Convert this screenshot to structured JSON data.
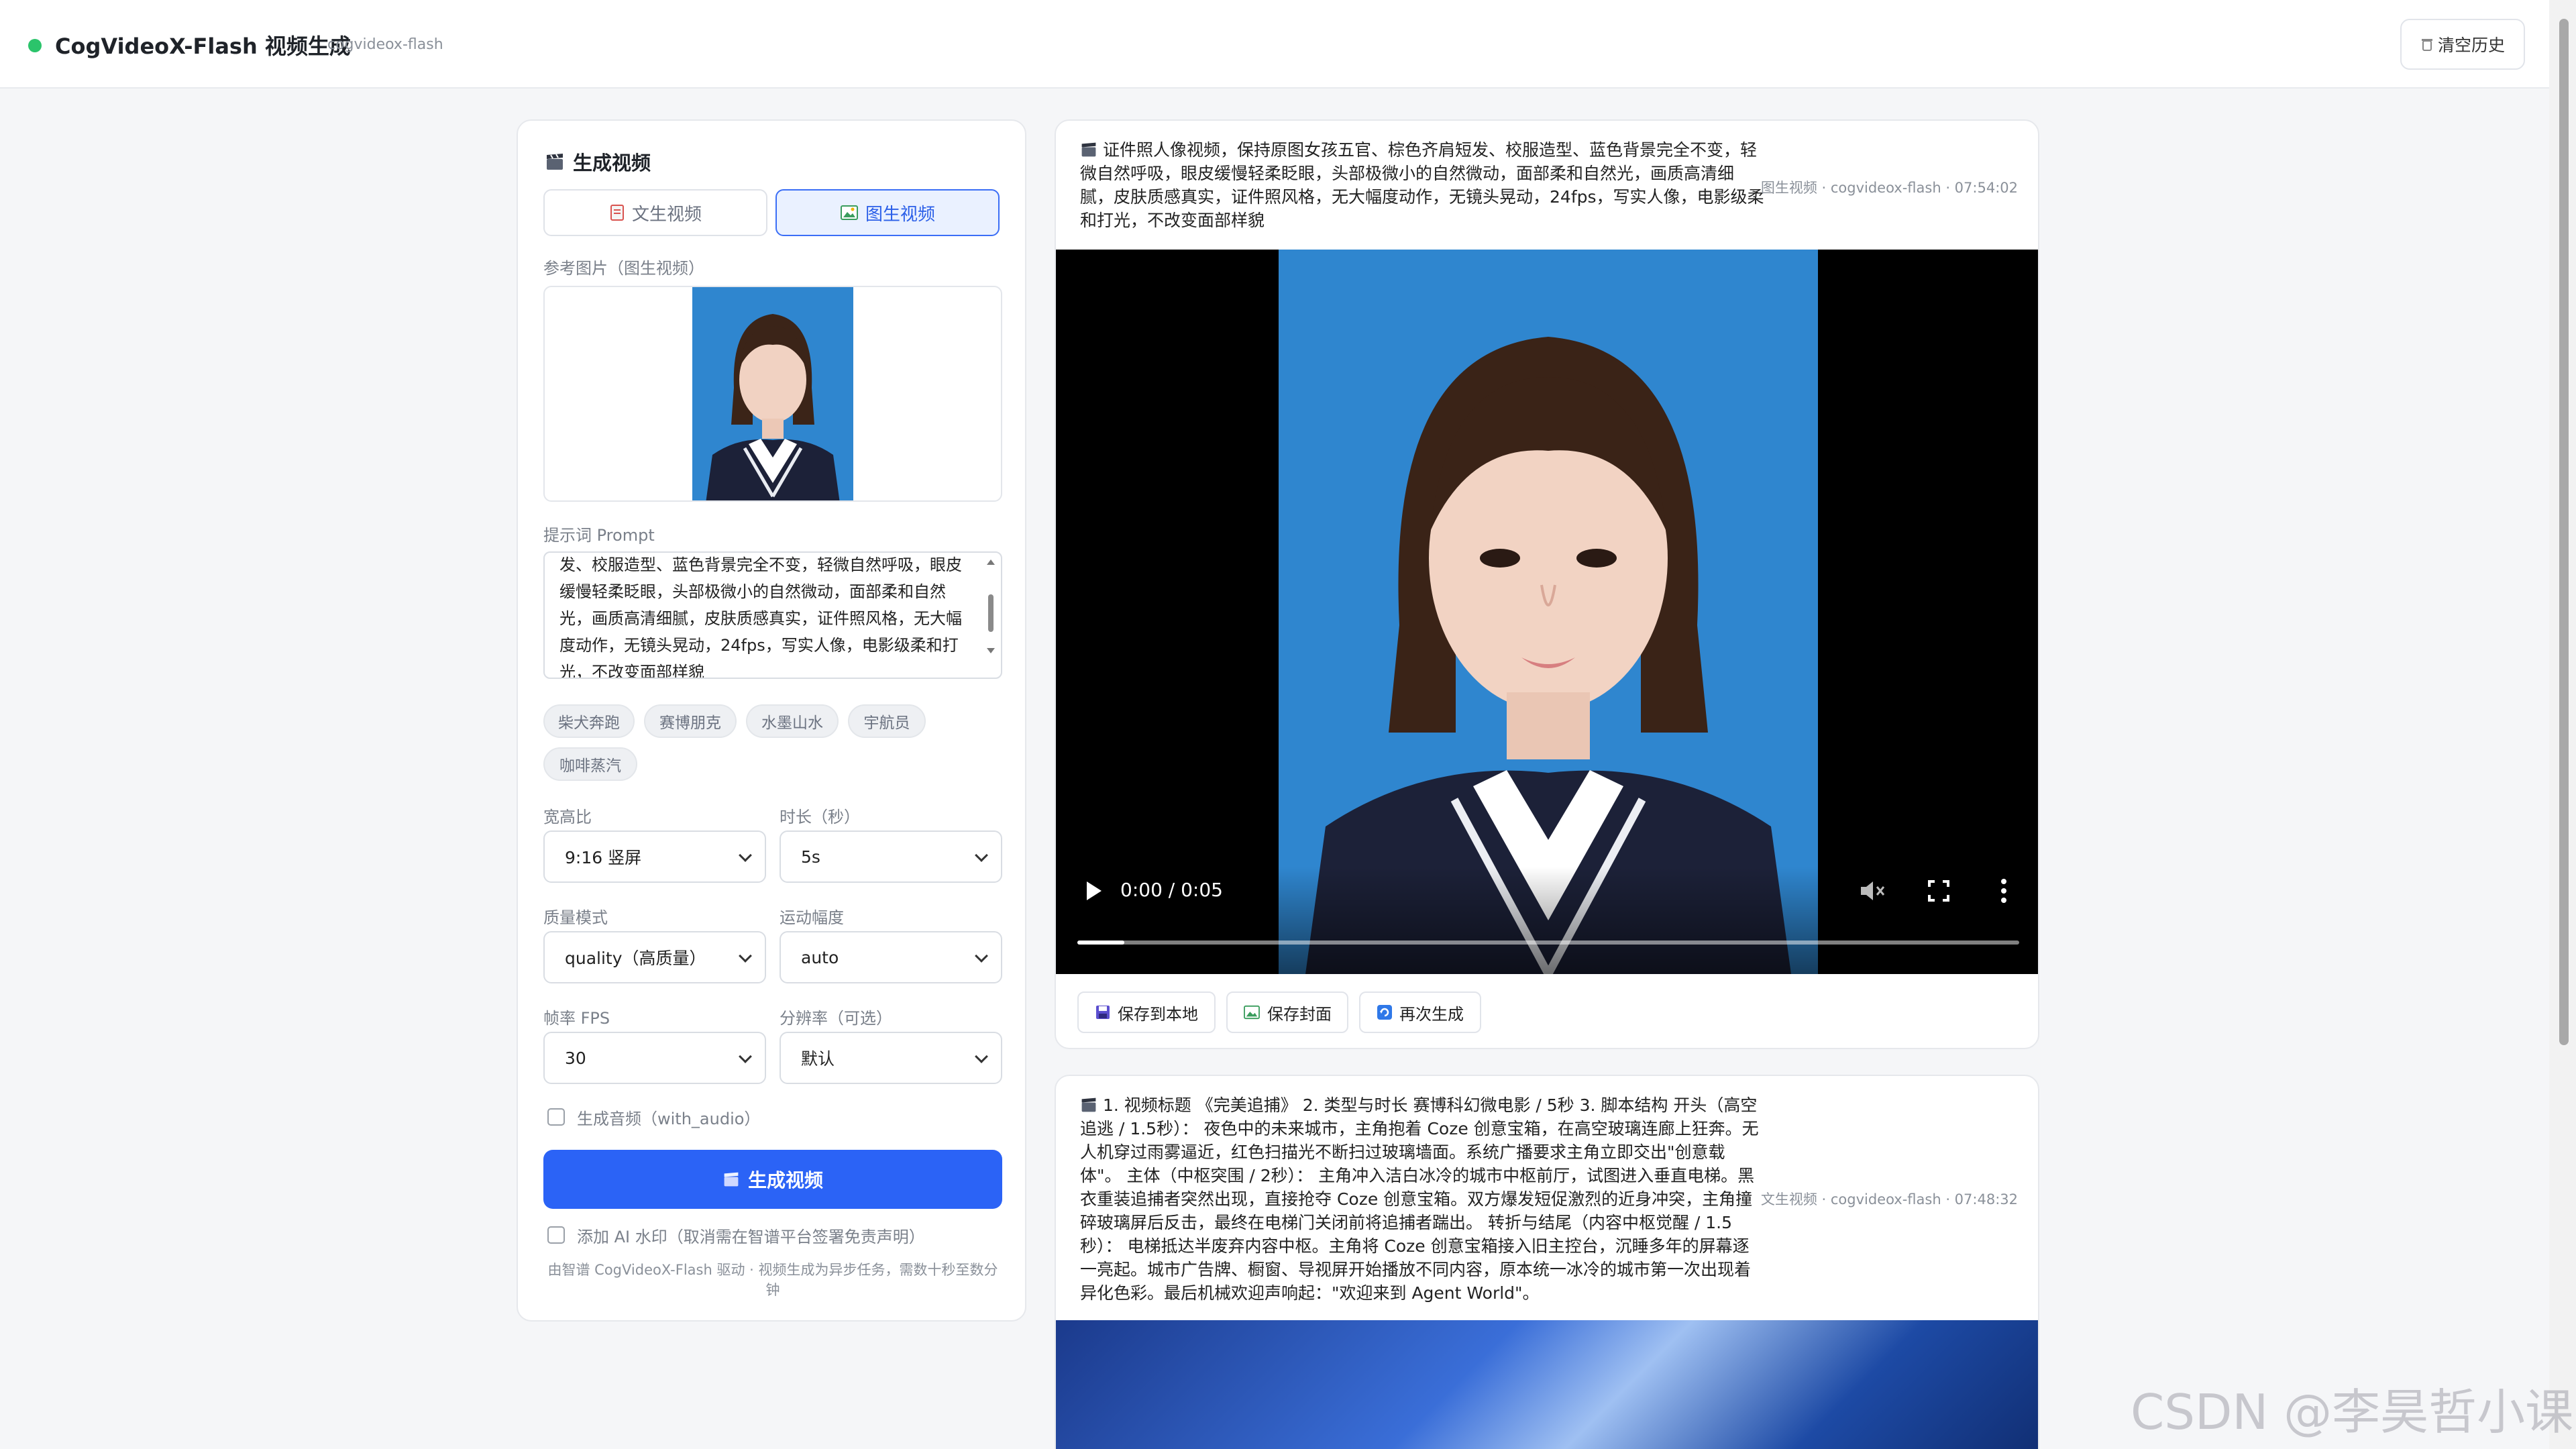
{
  "header": {
    "title": "CogVideoX-Flash 视频生成",
    "model": "cogvideox-flash",
    "clear_history": "清空历史"
  },
  "panel": {
    "title": "生成视频",
    "tabs": [
      {
        "label": "文生视频",
        "active": false
      },
      {
        "label": "图生视频",
        "active": true
      }
    ],
    "ref_image_label": "参考图片（图生视频）",
    "prompt_label": "提示词 Prompt",
    "prompt_value": "发、校服造型、蓝色背景完全不变，轻微自然呼吸，眼皮缓慢轻柔眨眼，头部极微小的自然微动，面部柔和自然光，画质高清细腻，皮肤质感真实，证件照风格，无大幅度动作，无镜头晃动，24fps，写实人像，电影级柔和打光，不改变面部样貌",
    "chips": [
      "柴犬奔跑",
      "赛博朋克",
      "水墨山水",
      "宇航员",
      "咖啡蒸汽"
    ],
    "fields": {
      "aspect": {
        "label": "宽高比",
        "value": "9:16 竖屏"
      },
      "duration": {
        "label": "时长（秒）",
        "value": "5s"
      },
      "quality": {
        "label": "质量模式",
        "value": "quality（高质量）"
      },
      "motion": {
        "label": "运动幅度",
        "value": "auto"
      },
      "fps": {
        "label": "帧率 FPS",
        "value": "30"
      },
      "resolution": {
        "label": "分辨率（可选）",
        "value": "默认"
      }
    },
    "audio_label": "生成音频（with_audio）",
    "generate_button": "生成视频",
    "watermark_label": "添加 AI 水印（取消需在智谱平台签署免责声明）",
    "footnote": "由智谱 CogVideoX-Flash 驱动 · 视频生成为异步任务，需数十秒至数分钟"
  },
  "history": [
    {
      "prompt": "证件照人像视频，保持原图女孩五官、棕色齐肩短发、校服造型、蓝色背景完全不变，轻微自然呼吸，眼皮缓慢轻柔眨眼，头部极微小的自然微动，面部柔和自然光，画质高清细腻，皮肤质感真实，证件照风格，无大幅度动作，无镜头晃动，24fps，写实人像，电影级柔和打光，不改变面部样貌",
      "meta": "图生视频 · cogvideox-flash · 07:54:02",
      "time": "0:00 / 0:05",
      "progress": 0.05,
      "actions": [
        "保存到本地",
        "保存封面",
        "再次生成"
      ]
    },
    {
      "prompt": "1. 视频标题 《完美追捕》 2. 类型与时长 赛博科幻微电影 / 5秒 3. 脚本结构 开头（高空追逃 / 1.5秒）： 夜色中的未来城市，主角抱着 Coze 创意宝箱，在高空玻璃连廊上狂奔。无人机穿过雨雾逼近，红色扫描光不断扫过玻璃墙面。系统广播要求主角立即交出\"创意载体\"。 主体（中枢突围 / 2秒）： 主角冲入洁白冰冷的城市中枢前厅，试图进入垂直电梯。黑衣重装追捕者突然出现，直接抢夺 Coze 创意宝箱。双方爆发短促激烈的近身冲突，主角撞碎玻璃屏后反击，最终在电梯门关闭前将追捕者踹出。 转折与结尾（内容中枢觉醒 / 1.5秒）： 电梯抵达半废弃内容中枢。主角将 Coze 创意宝箱接入旧主控台，沉睡多年的屏幕逐一亮起。城市广告牌、橱窗、导视屏开始播放不同内容，原本统一冰冷的城市第一次出现着异化色彩。最后机械欢迎声响起：\"欢迎来到 Agent World\"。",
      "meta": "文生视频 · cogvideox-flash · 07:48:32"
    }
  ],
  "watermark": "CSDN @李昊哲小课",
  "colors": {
    "accent": "#2b63f6",
    "status": "#2bc46b",
    "portrait_bg": "#2f86cf"
  }
}
